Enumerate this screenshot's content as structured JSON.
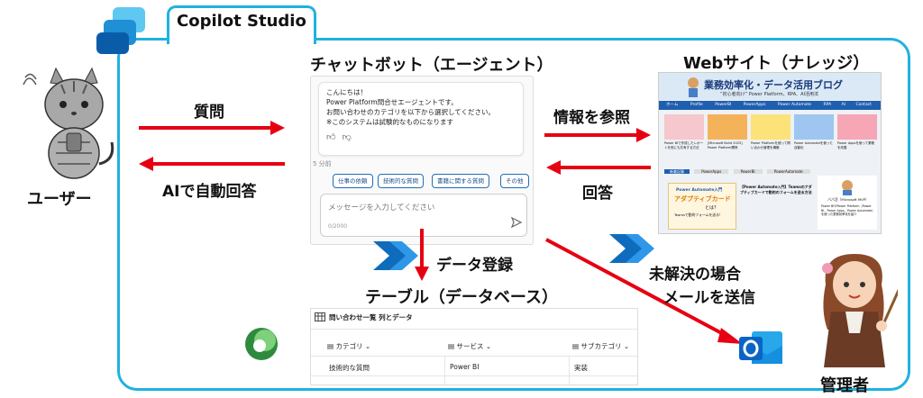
{
  "app": {
    "title": "Copilot Studio"
  },
  "actors": {
    "user": "ユーザー",
    "admin": "管理者"
  },
  "chatbot": {
    "title": "チャットボット（エージェント）",
    "messages": [
      "こんにちは！",
      "Power Platform問合せエージェントです。",
      "お問い合わせのカテゴリを以下から選択してください。",
      "※このシステムは試験的なものになります"
    ],
    "time": "5 分前",
    "chips": [
      "仕事の依頼",
      "技術的な質問",
      "書籍に関する質問",
      "その他"
    ],
    "input_placeholder": "メッセージを入力してください",
    "char_count": "0/2000"
  },
  "website": {
    "title": "Webサイト（ナレッジ）",
    "blog_title": "業務効率化・データ活用ブログ",
    "blog_subtitle": "“初心者向け” Power Platform、RPA、AI活用法",
    "nav": [
      "ホーム",
      "Profile",
      "PowerBI",
      "PowerApps",
      "Power Automate",
      "RPA",
      "AI",
      "Contact"
    ],
    "card_texts": [
      "Power BIで作成したレポートを他にも共有する方法",
      "[Microsoft Build 2025] Power Platform関係",
      "Power Platformを使って問い合わせ管理を構築",
      "Power Automateを使った自動化",
      "Power Appsを使って業務を改善"
    ],
    "tabs": [
      "新着記事",
      "PowerApps",
      "PowerBI",
      "PowerAutomate"
    ],
    "feature_label": "Power Automate入門",
    "feature_title": "アダプティブカード",
    "feature_sub": "とは？",
    "feature_note": "Teamsで動的フォームを送る！",
    "article_title": "【Power Automate入門】Teamsのアダプティブカードで動的のフォームを送る方法",
    "profile_name": "パパ活（Microsoft MVP）",
    "profile_text": "Power BIやPower Platform（Power BI、Power Apps、Power Automate）を使った業務効率化を紹介"
  },
  "arrows": {
    "question": "質問",
    "ai_answer": "AIで自動回答",
    "reference": "情報を参照",
    "answer": "回答",
    "data_register": "データ登録",
    "unresolved_1": "未解決の場合",
    "unresolved_2": "メールを送信"
  },
  "table": {
    "section_title": "テーブル（データベース）",
    "title": "問い合わせ一覧 列とデータ",
    "columns": [
      "カテゴリ",
      "サービス",
      "サブカテゴリ"
    ],
    "rows": [
      [
        "技術的な質問",
        "Power BI",
        "実装"
      ]
    ]
  },
  "colors": {
    "frame": "#1fb2df",
    "arrow": "#e60012",
    "automate": "#0f6cbd",
    "outlook": "#0a64c4",
    "dataverse": "#3a9b3a"
  }
}
